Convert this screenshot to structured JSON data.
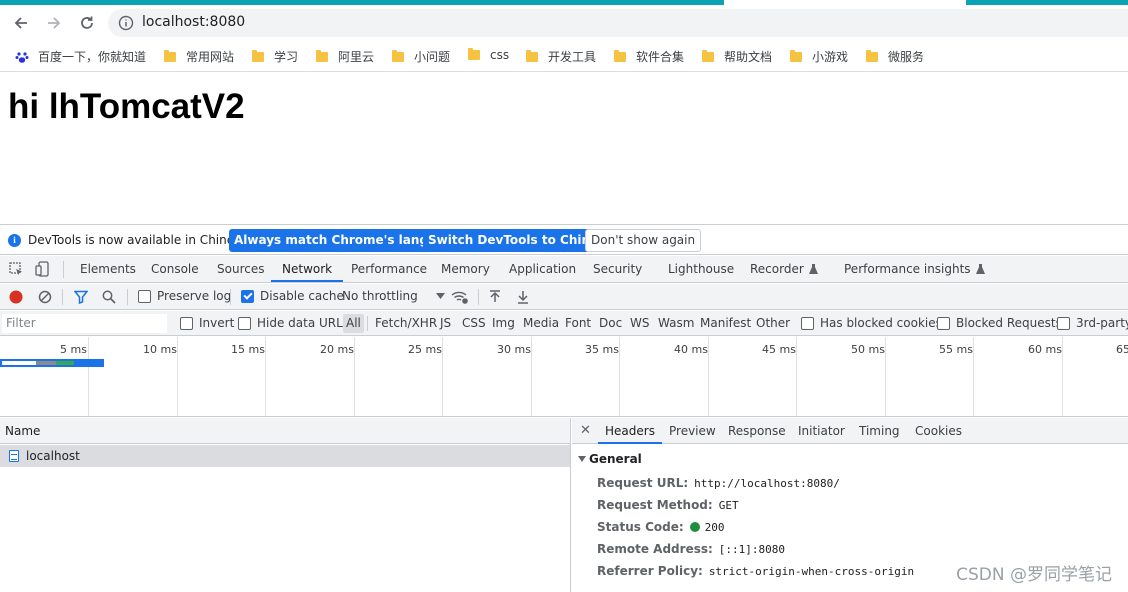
{
  "browser": {
    "url": "localhost:8080",
    "bookmarks": [
      {
        "label": "百度一下，你就知道",
        "icon": "baidu-paw-icon"
      },
      {
        "label": "常用网站",
        "icon": "folder-icon"
      },
      {
        "label": "学习",
        "icon": "folder-icon"
      },
      {
        "label": "阿里云",
        "icon": "folder-icon"
      },
      {
        "label": "小问题",
        "icon": "folder-icon"
      },
      {
        "label": "css",
        "icon": "folder-icon"
      },
      {
        "label": "开发工具",
        "icon": "folder-icon"
      },
      {
        "label": "软件合集",
        "icon": "folder-icon"
      },
      {
        "label": "帮助文档",
        "icon": "folder-icon"
      },
      {
        "label": "小游戏",
        "icon": "folder-icon"
      },
      {
        "label": "微服务",
        "icon": "folder-icon"
      }
    ]
  },
  "page": {
    "heading": "hi lhTomcatV2"
  },
  "devtools": {
    "infobar": {
      "message": "DevTools is now available in Chinese!",
      "match_button": "Always match Chrome's language",
      "switch_button": "Switch DevTools to Chinese",
      "dismiss_button": "Don't show again"
    },
    "tabs": [
      "Elements",
      "Console",
      "Sources",
      "Network",
      "Performance",
      "Memory",
      "Application",
      "Security",
      "Lighthouse",
      "Recorder",
      "Performance insights"
    ],
    "active_tab": "Network",
    "toolbar": {
      "preserve_log": "Preserve log",
      "disable_cache": "Disable cache",
      "throttling": "No throttling"
    },
    "filter": {
      "placeholder": "Filter",
      "invert": "Invert",
      "hide_data_urls": "Hide data URLs",
      "types": [
        "All",
        "Fetch/XHR",
        "JS",
        "CSS",
        "Img",
        "Media",
        "Font",
        "Doc",
        "WS",
        "Wasm",
        "Manifest",
        "Other"
      ],
      "has_blocked_cookies": "Has blocked cookies",
      "blocked_requests": "Blocked Requests",
      "third_party": "3rd-party"
    },
    "timeline_ticks": [
      "5 ms",
      "10 ms",
      "15 ms",
      "20 ms",
      "25 ms",
      "30 ms",
      "35 ms",
      "40 ms",
      "45 ms",
      "50 ms",
      "55 ms",
      "60 ms",
      "65"
    ],
    "requests": {
      "column_name": "Name",
      "rows": [
        {
          "name": "localhost"
        }
      ]
    },
    "details": {
      "tabs": [
        "Headers",
        "Preview",
        "Response",
        "Initiator",
        "Timing",
        "Cookies"
      ],
      "active_tab": "Headers",
      "section": "General",
      "fields": [
        {
          "key": "Request URL:",
          "value": "http://localhost:8080/"
        },
        {
          "key": "Request Method:",
          "value": "GET"
        },
        {
          "key": "Status Code:",
          "value": "200"
        },
        {
          "key": "Remote Address:",
          "value": "[::1]:8080"
        },
        {
          "key": "Referrer Policy:",
          "value": "strict-origin-when-cross-origin"
        }
      ]
    }
  },
  "watermark": "CSDN @罗同学笔记",
  "colors": {
    "accent": "#1a73e8",
    "tabstrip": "#0aa3b5",
    "status_ok": "#1e8e3e",
    "record": "#d93025"
  }
}
